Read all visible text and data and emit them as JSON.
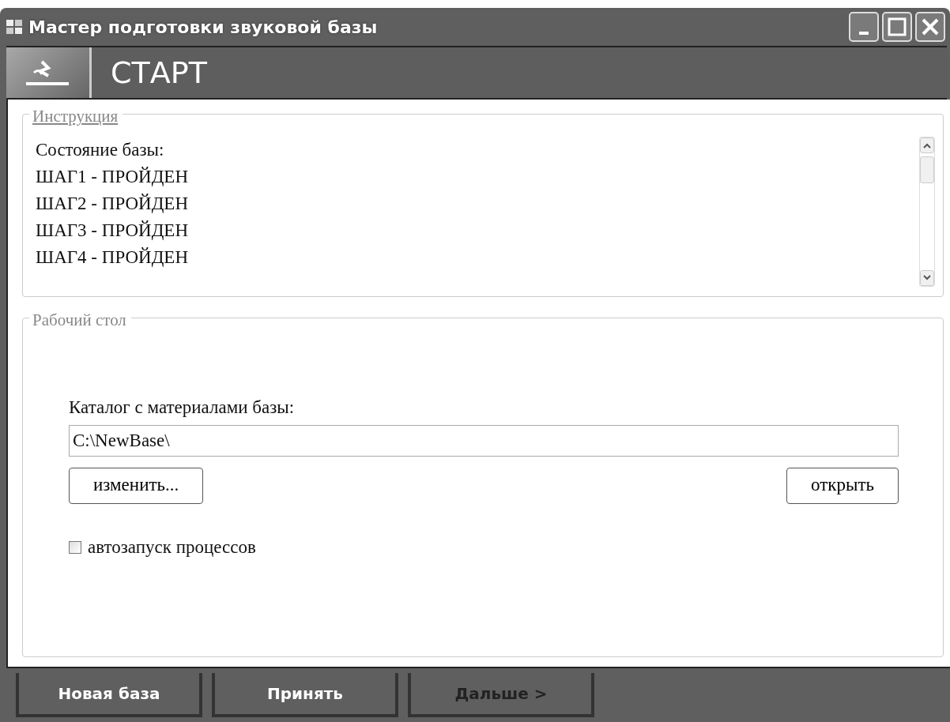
{
  "window": {
    "title": "Мастер подготовки звуковой базы"
  },
  "header": {
    "title": "СТАРТ"
  },
  "instruction": {
    "legend": "Инструкция",
    "lines": [
      "Состояние базы:",
      "ШАГ1 - ПРОЙДЕН",
      "ШАГ2 - ПРОЙДЕН",
      "ШАГ3 - ПРОЙДЕН",
      "ШАГ4 - ПРОЙДЕН"
    ]
  },
  "workspace": {
    "legend": "Рабочий стол",
    "folder_label": "Каталог с материалами базы:",
    "folder_value": "C:\\NewBase\\",
    "change_button": "изменить...",
    "open_button": "открыть",
    "autostart": {
      "label": "автозапуск процессов",
      "checked": false
    }
  },
  "footer_buttons": [
    {
      "label": "Новая база",
      "disabled": false
    },
    {
      "label": "Принять",
      "disabled": false
    },
    {
      "label": "Дальше >",
      "disabled": true
    }
  ]
}
